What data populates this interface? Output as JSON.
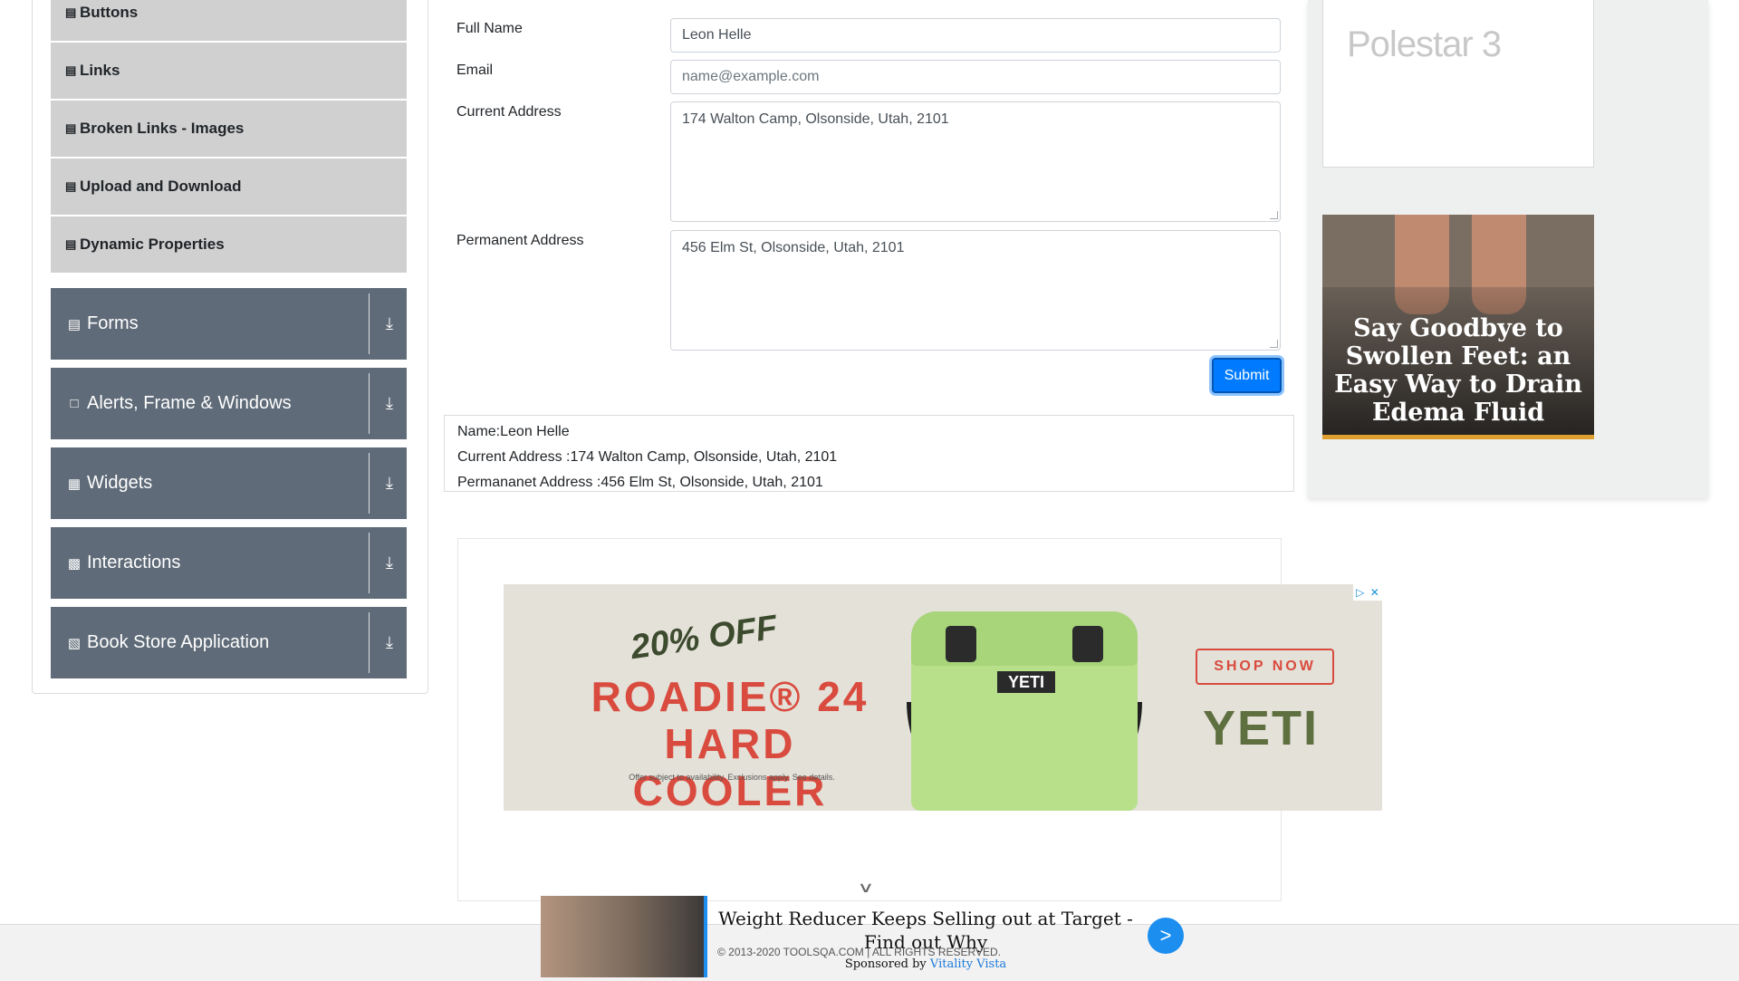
{
  "sidebar": {
    "element_items": [
      {
        "label": "Buttons"
      },
      {
        "label": "Links"
      },
      {
        "label": "Broken Links - Images"
      },
      {
        "label": "Upload and Download"
      },
      {
        "label": "Dynamic Properties"
      }
    ],
    "groups": [
      {
        "label": "Forms",
        "icon": "form-icon"
      },
      {
        "label": "Alerts, Frame & Windows",
        "icon": "window-icon"
      },
      {
        "label": "Widgets",
        "icon": "widgets-icon"
      },
      {
        "label": "Interactions",
        "icon": "interactions-icon"
      },
      {
        "label": "Book Store Application",
        "icon": "books-icon"
      }
    ]
  },
  "form": {
    "full_name_label": "Full Name",
    "full_name_value": "Leon Helle",
    "email_label": "Email",
    "email_placeholder": "name@example.com",
    "current_address_label": "Current Address",
    "current_address_value": "174 Walton Camp, Olsonside, Utah, 2101",
    "permanent_address_label": "Permanent Address",
    "permanent_address_value": "456 Elm St, Olsonside, Utah, 2101",
    "submit_label": "Submit"
  },
  "output": {
    "name": "Name:Leon Helle",
    "current_address": "Current Address :174 Walton Camp, Olsonside, Utah, 2101",
    "permanent_address": "Permananet Address :456 Elm St, Olsonside, Utah, 2101"
  },
  "ads": {
    "yeti": {
      "discount": "20% OFF",
      "product_line1": "ROADIE® 24",
      "product_line2": "HARD COOLER",
      "fine_print": "Offer subject to availability. Exclusions apply. See details.",
      "cta": "SHOP NOW",
      "brand": "YETI",
      "badge": "YETI"
    },
    "polestar": "Polestar 3",
    "feet": "Say Goodbye to Swollen Feet: an Easy Way to Drain Edema Fluid",
    "bottom": {
      "title": "Weight Reducer Keeps Selling out at Target - Find out Why",
      "sponsored_prefix": "Sponsored by",
      "sponsor": "Vitality Vista",
      "go": ">"
    }
  },
  "footer": {
    "copyright": "© 2013-2020 TOOLSQA.COM | ALL RIGHTS RESERVED."
  },
  "colors": {
    "sidebar_group_bg": "#5f6b78",
    "sidebar_item_bg": "#d0d0d0",
    "primary": "#007bff"
  }
}
